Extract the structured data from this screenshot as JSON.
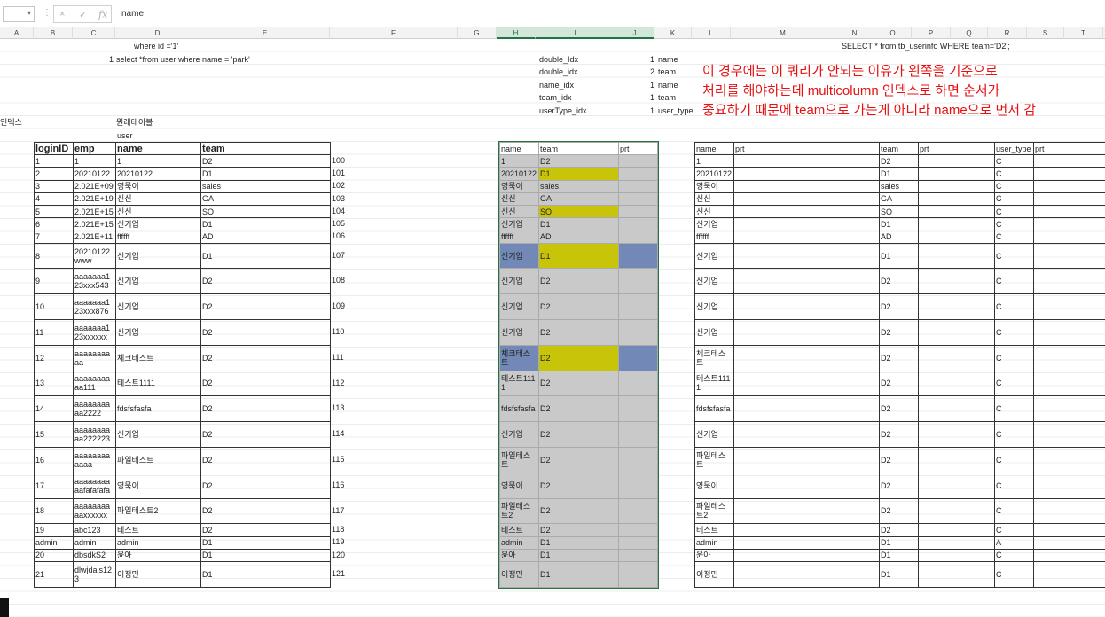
{
  "formula_bar": {
    "cell_ref": "",
    "formula": "name",
    "cancel_icon": "×",
    "enter_icon": "✓",
    "fx_icon": "fx"
  },
  "columns": [
    "A",
    "B",
    "C",
    "D",
    "E",
    "F",
    "G",
    "H",
    "I",
    "J",
    "K",
    "L",
    "M",
    "N",
    "O",
    "P",
    "Q",
    "R",
    "S",
    "T"
  ],
  "texts": {
    "where_id": "where id ='1'",
    "row1_num": "1",
    "select_park": "select *from user where name = 'park'",
    "index_label": "인덱스",
    "original_table": "원래테이블",
    "user": "user",
    "select_team": "SELECT * from tb_userinfo WHERE team='D2';"
  },
  "index_list": [
    {
      "name": "double_Idx",
      "seq": "1",
      "col": "name"
    },
    {
      "name": "double_idx",
      "seq": "2",
      "col": "team"
    },
    {
      "name": "name_idx",
      "seq": "1",
      "col": "name"
    },
    {
      "name": "team_idx",
      "seq": "1",
      "col": "team"
    },
    {
      "name": "userType_idx",
      "seq": "1",
      "col": "user_type"
    }
  ],
  "annotation": [
    "이 경우에는 이 쿼리가 안되는 이유가 왼쪽을 기준으로",
    "처리를 해야하는데 multicolumn 인덱스로 하면 순서가",
    "중요하기 때문에 team으로 가는게 아니라 name으로 먼저 감"
  ],
  "main_table": {
    "headers": [
      "loginID",
      "emp",
      "name",
      "team"
    ],
    "rows": [
      [
        "1",
        "1",
        "1",
        "D2",
        "100"
      ],
      [
        "2",
        "20210122",
        "20210122",
        "D1",
        "101"
      ],
      [
        "3",
        "2.021E+09",
        "영묵이",
        "sales",
        "102"
      ],
      [
        "4",
        "2.021E+19",
        "신신",
        "GA",
        "103"
      ],
      [
        "5",
        "2.021E+15",
        "신신",
        "SO",
        "104"
      ],
      [
        "6",
        "2.021E+15",
        "신기업",
        "D1",
        "105"
      ],
      [
        "7",
        "2.021E+11",
        "ffffff",
        "AD",
        "106"
      ],
      [
        "8",
        "20210122www",
        "신기업",
        "D1",
        "107"
      ],
      [
        "9",
        "aaaaaaa123xxx543",
        "신기업",
        "D2",
        "108"
      ],
      [
        "10",
        "aaaaaaa123xxx876",
        "신기업",
        "D2",
        "109"
      ],
      [
        "11",
        "aaaaaaa123xxxxxx",
        "신기업",
        "D2",
        "110"
      ],
      [
        "12",
        "aaaaaaaaaa",
        "체크테스트",
        "D2",
        "111"
      ],
      [
        "13",
        "aaaaaaaaaa111",
        "테스트1111",
        "D2",
        "112"
      ],
      [
        "14",
        "aaaaaaaaaa2222",
        "fdsfsfasfa",
        "D2",
        "113"
      ],
      [
        "15",
        "aaaaaaaaaa222223",
        "신기업",
        "D2",
        "114"
      ],
      [
        "16",
        "aaaaaaaaaaaa",
        "파일테스트",
        "D2",
        "115"
      ],
      [
        "17",
        "aaaaaaaaaafafafafa",
        "영묵이",
        "D2",
        "116"
      ],
      [
        "18",
        "aaaaaaaaaaxxxxxx",
        "파일테스트2",
        "D2",
        "117"
      ],
      [
        "19",
        "abc123",
        "테스트",
        "D2",
        "118"
      ],
      [
        "admin",
        "admin",
        "admin",
        "D1",
        "119"
      ],
      [
        "20",
        "dbsdkS2",
        "윤아",
        "D1",
        "120"
      ],
      [
        "21",
        "dlwjdals123",
        "이정민",
        "D1",
        "121"
      ]
    ]
  },
  "h_table": {
    "headers": [
      "name",
      "team",
      "prt"
    ],
    "rows": [
      [
        "1",
        "D2",
        ""
      ],
      [
        "20210122",
        "D1",
        ""
      ],
      [
        "영묵이",
        "sales",
        ""
      ],
      [
        "신신",
        "GA",
        ""
      ],
      [
        "신신",
        "SO",
        ""
      ],
      [
        "신기업",
        "D1",
        ""
      ],
      [
        "ffffff",
        "AD",
        ""
      ],
      [
        "신기업",
        "D1",
        ""
      ],
      [
        "신기업",
        "D2",
        ""
      ],
      [
        "신기업",
        "D2",
        ""
      ],
      [
        "신기업",
        "D2",
        ""
      ],
      [
        "체크테스트",
        "D2",
        ""
      ],
      [
        "테스트1111",
        "D2",
        ""
      ],
      [
        "fdsfsfasfa",
        "D2",
        ""
      ],
      [
        "신기업",
        "D2",
        ""
      ],
      [
        "파일테스트",
        "D2",
        ""
      ],
      [
        "영묵이",
        "D2",
        ""
      ],
      [
        "파일테스트2",
        "D2",
        ""
      ],
      [
        "테스트",
        "D2",
        ""
      ],
      [
        "admin",
        "D1",
        ""
      ],
      [
        "윤아",
        "D1",
        ""
      ],
      [
        "이정민",
        "D1",
        ""
      ]
    ]
  },
  "l_table": {
    "headers": [
      "name",
      "prt"
    ],
    "rows": [
      [
        "1",
        ""
      ],
      [
        "20210122",
        ""
      ],
      [
        "영묵이",
        ""
      ],
      [
        "신신",
        ""
      ],
      [
        "신신",
        ""
      ],
      [
        "신기업",
        ""
      ],
      [
        "ffffff",
        ""
      ],
      [
        "신기업",
        ""
      ],
      [
        "신기업",
        ""
      ],
      [
        "신기업",
        ""
      ],
      [
        "신기업",
        ""
      ],
      [
        "체크테스트",
        ""
      ],
      [
        "테스트1111",
        ""
      ],
      [
        "fdsfsfasfa",
        ""
      ],
      [
        "신기업",
        ""
      ],
      [
        "파일테스트",
        ""
      ],
      [
        "영묵이",
        ""
      ],
      [
        "파일테스트2",
        ""
      ],
      [
        "테스트",
        ""
      ],
      [
        "admin",
        ""
      ],
      [
        "윤아",
        ""
      ],
      [
        "이정민",
        ""
      ]
    ]
  },
  "o_table": {
    "headers": [
      "team",
      "prt"
    ],
    "rows": [
      [
        "D2",
        ""
      ],
      [
        "D1",
        ""
      ],
      [
        "sales",
        ""
      ],
      [
        "GA",
        ""
      ],
      [
        "SO",
        ""
      ],
      [
        "D1",
        ""
      ],
      [
        "AD",
        ""
      ],
      [
        "D1",
        ""
      ],
      [
        "D2",
        ""
      ],
      [
        "D2",
        ""
      ],
      [
        "D2",
        ""
      ],
      [
        "D2",
        ""
      ],
      [
        "D2",
        ""
      ],
      [
        "D2",
        ""
      ],
      [
        "D2",
        ""
      ],
      [
        "D2",
        ""
      ],
      [
        "D2",
        ""
      ],
      [
        "D2",
        ""
      ],
      [
        "D2",
        ""
      ],
      [
        "D1",
        ""
      ],
      [
        "D1",
        ""
      ],
      [
        "D1",
        ""
      ]
    ]
  },
  "r_table": {
    "headers": [
      "user_type",
      "prt"
    ],
    "rows": [
      [
        "C",
        ""
      ],
      [
        "C",
        ""
      ],
      [
        "C",
        ""
      ],
      [
        "C",
        ""
      ],
      [
        "C",
        ""
      ],
      [
        "C",
        ""
      ],
      [
        "C",
        ""
      ],
      [
        "C",
        ""
      ],
      [
        "C",
        ""
      ],
      [
        "C",
        ""
      ],
      [
        "C",
        ""
      ],
      [
        "C",
        ""
      ],
      [
        "C",
        ""
      ],
      [
        "C",
        ""
      ],
      [
        "C",
        ""
      ],
      [
        "C",
        ""
      ],
      [
        "C",
        ""
      ],
      [
        "C",
        ""
      ],
      [
        "C",
        ""
      ],
      [
        "A",
        ""
      ],
      [
        "C",
        ""
      ],
      [
        "C",
        ""
      ]
    ]
  },
  "colors": {
    "highlight_yellow": "#c8c40a",
    "highlight_blue": "#7288b6",
    "selection_gray": "#c9c9c9",
    "annotation_red": "#e81010",
    "excel_green": "#217346"
  }
}
